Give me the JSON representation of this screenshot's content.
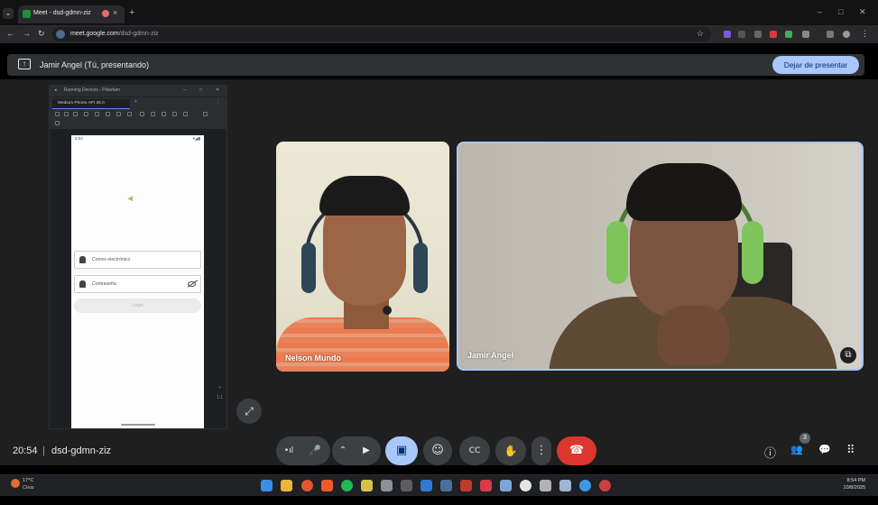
{
  "browser": {
    "tab_title": "Meet - dsd-gdmn-ziz",
    "tab_close": "×",
    "new_tab": "+",
    "url_host": "meet.google.com",
    "url_path": "/dsd-gdmn-ziz",
    "window_controls": [
      "–",
      "□",
      "✕"
    ]
  },
  "present_bar": {
    "label": "Jamir Angel (Tú, presentando)",
    "stop_button": "Dejar de presentar"
  },
  "shared_screen": {
    "window_title": "Running Devices - Pokefam",
    "device_tab": "Medium Phone API 36.0",
    "phone_time": "5:54",
    "email_placeholder": "Correo electrónico",
    "password_placeholder": "Contraseña",
    "login_button": "Login",
    "side_controls": [
      "+",
      "1:1"
    ]
  },
  "participants": [
    {
      "name": "Nelson Mundo"
    },
    {
      "name": "Jamir Angel"
    }
  ],
  "meeting": {
    "time": "20:54",
    "separator": "|",
    "code": "dsd-gdmn-ziz",
    "people_count": "3"
  },
  "controls": {
    "audio_levels": "•ıl",
    "mic": "🎤",
    "more_options_arrow": "⌃",
    "camera": "▶",
    "present": "▣",
    "emoji": "☺",
    "captions": "CC",
    "raise_hand": "✋",
    "more": "⋮",
    "leave": "☎",
    "info": "ⓘ",
    "people": "👥",
    "chat": "💬",
    "activities": "⠿"
  },
  "taskbar": {
    "weather_temp": "17°C",
    "weather_desc": "Clear",
    "clock_time": "8:54 PM",
    "clock_date": "10/8/2025"
  },
  "colors": {
    "accent_blue": "#a8c7fa",
    "leave_red": "#dc362e",
    "control_grey": "#3c4043"
  }
}
